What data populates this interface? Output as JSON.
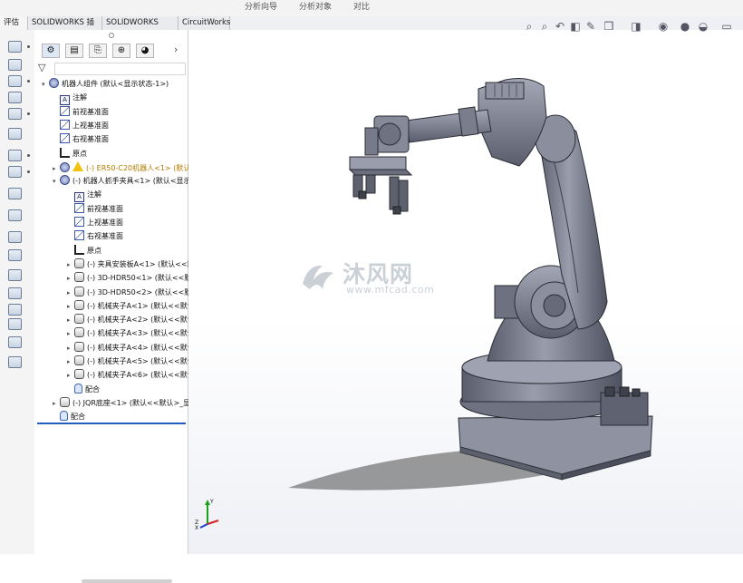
{
  "ribbon": {
    "remnant_1": "分析向导",
    "remnant_2": "分析对象",
    "remnant_3": "对比"
  },
  "tabs": [
    {
      "label": "评估"
    },
    {
      "label": "SOLIDWORKS 插件"
    },
    {
      "label": "SOLIDWORKS MBD"
    },
    {
      "label": "CircuitWorks"
    }
  ],
  "feature_manager": {
    "panel_tabs": [
      {
        "icon": "feature-tree-icon"
      },
      {
        "icon": "property-manager-icon"
      },
      {
        "icon": "configuration-manager-icon"
      },
      {
        "icon": "dimxpert-icon"
      },
      {
        "icon": "display-manager-icon"
      }
    ],
    "rows": [
      {
        "text": "机器人组件  (默认<显示状态-1>)",
        "icon": "assembly-icon",
        "indent": 0
      },
      {
        "text": "注解",
        "icon": "annotation-icon",
        "indent": 1
      },
      {
        "text": "前视基准面",
        "icon": "plane-icon",
        "indent": 1
      },
      {
        "text": "上视基准面",
        "icon": "plane-icon",
        "indent": 1
      },
      {
        "text": "右视基准面",
        "icon": "plane-icon",
        "indent": 1
      },
      {
        "text": "原点",
        "icon": "origin-icon",
        "indent": 1
      },
      {
        "text": "(-) ER50-C20机器人<1> (默认",
        "icon": "warning-icon",
        "indent": 1,
        "warn": true
      },
      {
        "text": "(-) 机器人抓手夹具<1> (默认<显示",
        "icon": "assembly-icon",
        "indent": 1
      },
      {
        "text": "注解",
        "icon": "annotation-icon",
        "indent": 2
      },
      {
        "text": "前视基准面",
        "icon": "plane-icon",
        "indent": 2
      },
      {
        "text": "上视基准面",
        "icon": "plane-icon",
        "indent": 2
      },
      {
        "text": "右视基准面",
        "icon": "plane-icon",
        "indent": 2
      },
      {
        "text": "原点",
        "icon": "origin-icon",
        "indent": 2
      },
      {
        "text": "(-) 夹具安装板A<1> (默认<<默",
        "icon": "part-icon",
        "indent": 2
      },
      {
        "text": "(-) 3D-HDR50<1> (默认<<默",
        "icon": "part-icon",
        "indent": 2
      },
      {
        "text": "(-) 3D-HDR50<2> (默认<<默",
        "icon": "part-icon",
        "indent": 2
      },
      {
        "text": "(-) 机械夹子A<1> (默认<<默认",
        "icon": "part-icon",
        "indent": 2
      },
      {
        "text": "(-) 机械夹子A<2> (默认<<默认",
        "icon": "part-icon",
        "indent": 2
      },
      {
        "text": "(-) 机械夹子A<3> (默认<<默认",
        "icon": "part-icon",
        "indent": 2
      },
      {
        "text": "(-) 机械夹子A<4> (默认<<默认",
        "icon": "part-icon",
        "indent": 2
      },
      {
        "text": "(-) 机械夹子A<5> (默认<<默认",
        "icon": "part-icon",
        "indent": 2
      },
      {
        "text": "(-) 机械夹子A<6> (默认<<默认",
        "icon": "part-icon",
        "indent": 2
      },
      {
        "text": "配合",
        "icon": "mate-icon",
        "indent": 2
      },
      {
        "text": "(-) JQR底座<1> (默认<<默认>_显",
        "icon": "part-icon",
        "indent": 1
      },
      {
        "text": "配合",
        "icon": "mate-icon",
        "indent": 1
      }
    ]
  },
  "viewport": {
    "toolbar_icons": [
      "zoom-to-fit-icon",
      "zoom-to-area-icon",
      "previous-view-icon",
      "section-view-icon",
      "dynamic-annotation-icon",
      "view-orientation-icon",
      "display-style-icon",
      "hide-show-icon",
      "edit-appearance-icon",
      "apply-scene-icon",
      "view-settings-icon"
    ],
    "watermark_cn": "沐风网",
    "watermark_url": "www.mfcad.com",
    "triad_labels": {
      "x": "X",
      "y": "Y",
      "z": "Z"
    },
    "colors": {
      "robot": "#8a8d9c",
      "robot_dark": "#4b4e5c",
      "bg_top": "#ffffff",
      "bg_bottom": "#f0f2f7"
    }
  }
}
